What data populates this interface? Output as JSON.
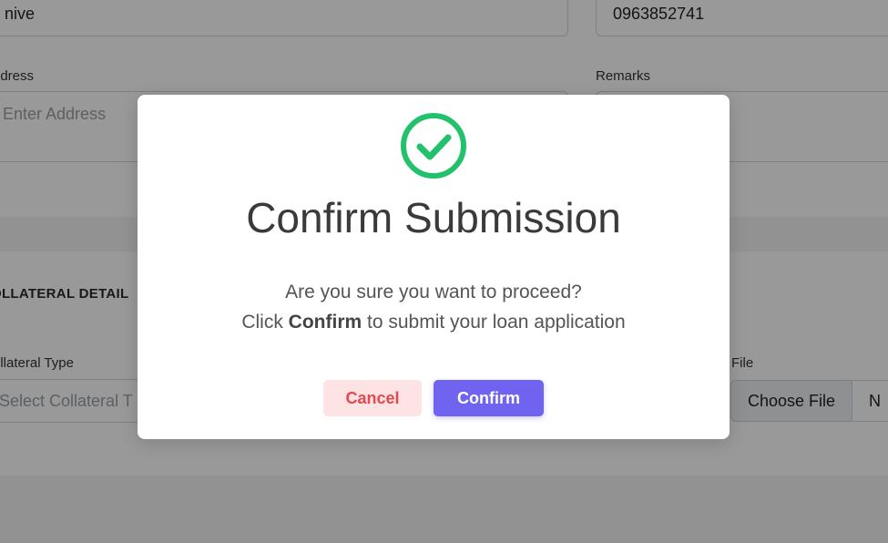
{
  "form": {
    "name_value": "nive",
    "phone_value": "0963852741",
    "address_label": "ddress",
    "address_placeholder": "Enter Address",
    "remarks_label": "Remarks",
    "section_title": "OLLATERAL DETAIL",
    "collateral_type_label": "ollateral Type",
    "collateral_type_placeholder": "Select Collateral T",
    "file_label": "File",
    "choose_file_label": "Choose File",
    "file_status_fragment": "N"
  },
  "modal": {
    "icon": "check-circle-icon",
    "title": "Confirm Submission",
    "message_line1": "Are you sure you want to proceed?",
    "message_line2_prefix": "Click ",
    "message_line2_bold": "Confirm",
    "message_line2_suffix": " to submit your loan application",
    "cancel_label": "Cancel",
    "confirm_label": "Confirm"
  },
  "colors": {
    "success_green": "#22c16b",
    "confirm_purple": "#6f63f0",
    "cancel_red": "#e5484d",
    "cancel_bg": "#fde3e4"
  }
}
